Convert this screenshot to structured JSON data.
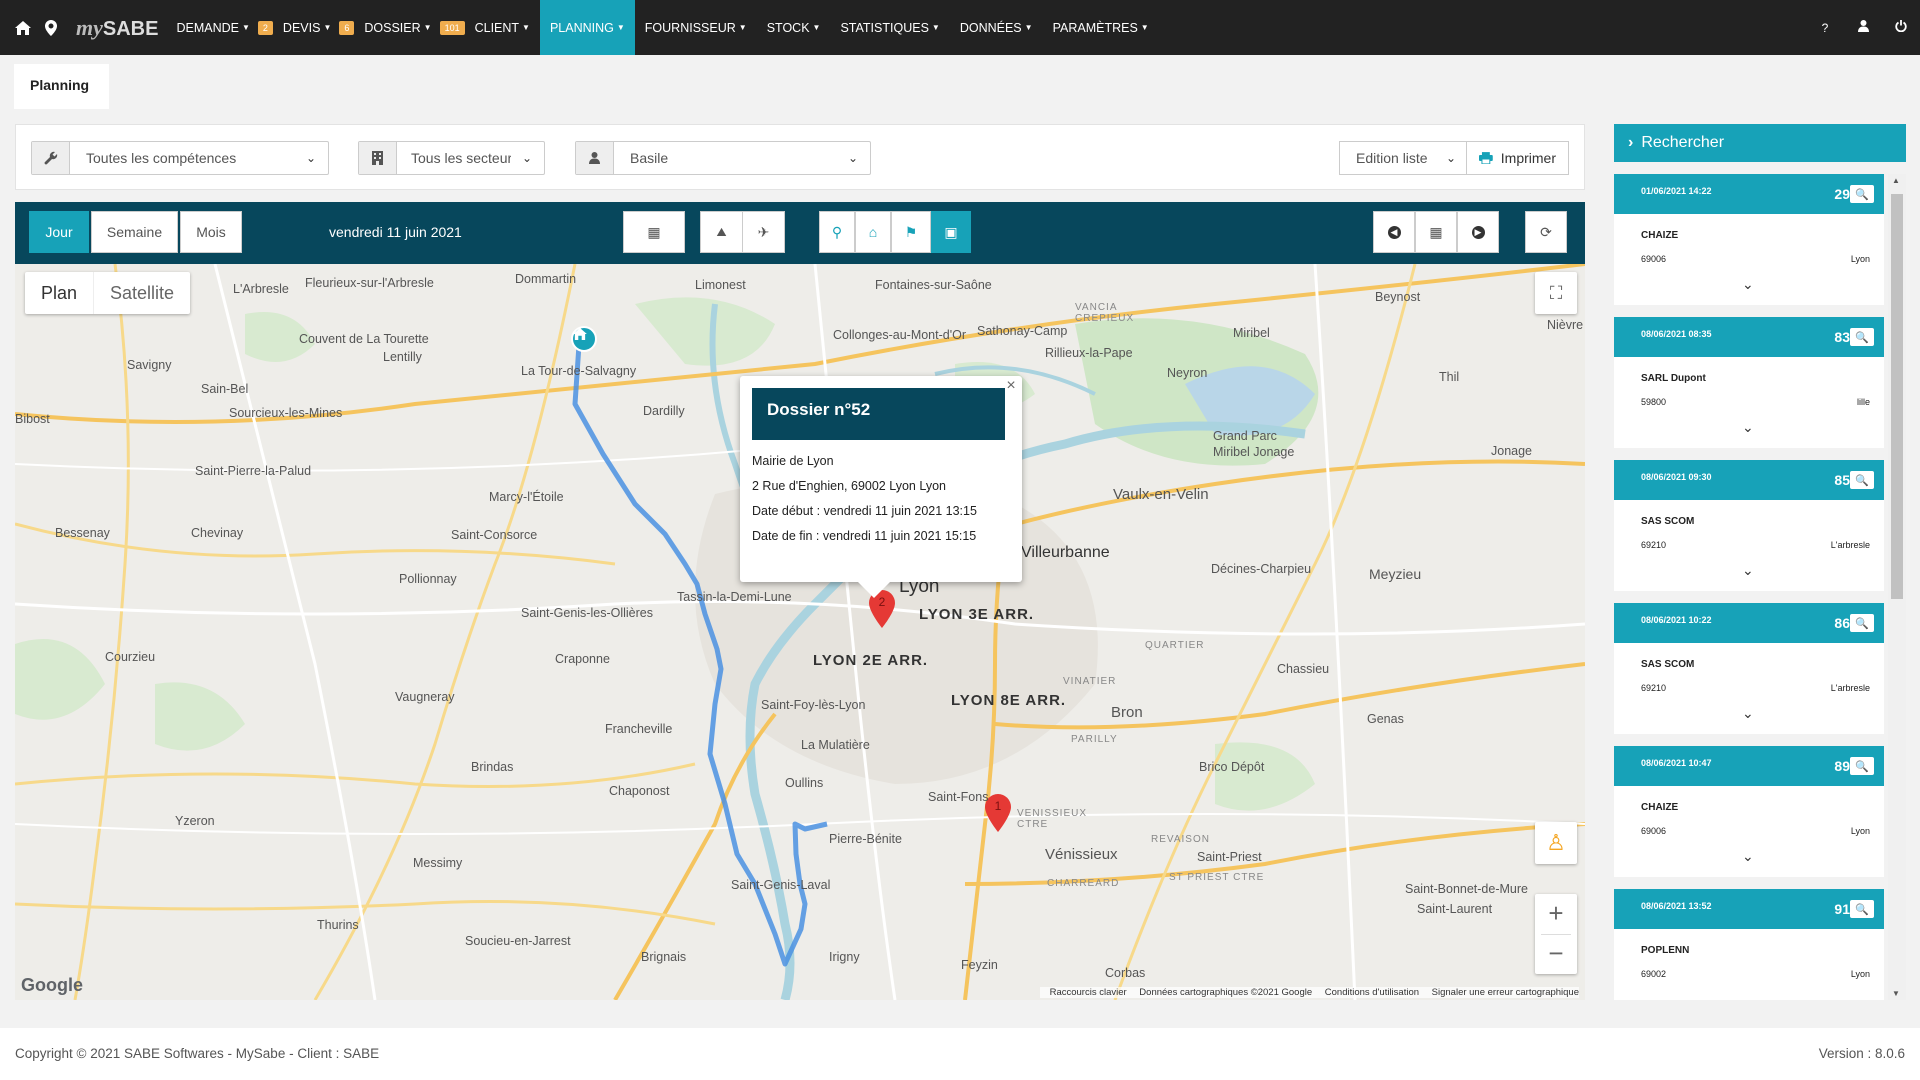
{
  "nav": {
    "logo_my": "my",
    "logo_sabe": "SABE",
    "items": [
      {
        "label": "DEMANDE",
        "badge": "2"
      },
      {
        "label": "DEVIS",
        "badge": "6"
      },
      {
        "label": "DOSSIER",
        "badge": "101"
      },
      {
        "label": "CLIENT",
        "badge": ""
      },
      {
        "label": "PLANNING",
        "badge": ""
      },
      {
        "label": "FOURNISSEUR",
        "badge": ""
      },
      {
        "label": "STOCK",
        "badge": ""
      },
      {
        "label": "STATISTIQUES",
        "badge": ""
      },
      {
        "label": "DONNÉES",
        "badge": ""
      },
      {
        "label": "PARAMÈTRES",
        "badge": ""
      }
    ],
    "help": "?"
  },
  "page": {
    "tab": "Planning"
  },
  "filters": {
    "competences": "Toutes les compétences",
    "secteurs": "Tous les secteurs",
    "user": "Basile",
    "edition": "Edition liste",
    "print": "Imprimer"
  },
  "planbar": {
    "jour": "Jour",
    "semaine": "Semaine",
    "mois": "Mois",
    "date": "vendredi 11 juin 2021"
  },
  "map": {
    "plan": "Plan",
    "satellite": "Satellite",
    "popup": {
      "title": "Dossier n°52",
      "line1": "Mairie de Lyon",
      "line2": "2 Rue d'Enghien, 69002 Lyon Lyon",
      "line3": "Date début : vendredi 11 juin 2021 13:15",
      "line4": "Date de fin : vendredi 11 juin 2021 15:15"
    },
    "markers": {
      "m1": "1",
      "m2": "2"
    },
    "labels": [
      "L'Arbresle",
      "Fleurieux-sur-l'Arbresle",
      "Dommartin",
      "Limonest",
      "Fontaines-sur-Saône",
      "Couvent de La Tourette",
      "Lentilly",
      "La Tour-de-Salvagny",
      "Collonges-au-Mont-d'Or",
      "Sathonay-Camp",
      "Rillieux-la-Pape",
      "Miribel",
      "Beynost",
      "Savigny",
      "Sain-Bel",
      "Sourcieux-les-Mines",
      "Dardilly",
      "Neyron",
      "Thil",
      "Bibost",
      "Saint-Pierre-la-Palud",
      "Grand Parc Miribel Jonage",
      "Jonage",
      "Marcy-l'Étoile",
      "Vaulx-en-Velin",
      "Bessenay",
      "Chevinay",
      "Saint-Consorce",
      "Villeurbanne",
      "Décines-Charpieu",
      "Meyzieu",
      "Pollionnay",
      "Tassin-la-Demi-Lune",
      "Lyon",
      "Saint-Genis-les-Ollières",
      "Courzieu",
      "Craponne",
      "Chassieu",
      "Vaugneray",
      "Saint-Foy-lès-Lyon",
      "Bron",
      "Genas",
      "Francheville",
      "La Mulatière",
      "Brindas",
      "Chaponost",
      "Oullins",
      "Saint-Fons",
      "Brico Dépôt",
      "Yzeron",
      "Pierre-Bénite",
      "Vénissieux",
      "Saint-Priest",
      "Messimy",
      "Saint-Genis-Laval",
      "Saint-Bonnet-de-Mure",
      "Saint-Laurent",
      "Thurins",
      "Soucieu-en-Jarrest",
      "Brignais",
      "Irigny",
      "Feyzin",
      "Corbas",
      "Nièvre"
    ],
    "districts": [
      "LYON 3E ARR.",
      "LYON 2E ARR.",
      "LYON 8E ARR."
    ],
    "small": [
      "VANCIA CREPIEUX",
      "QUARTIER",
      "VINATIER",
      "PARILLY",
      "REVAISON",
      "ST PRIEST CTRE",
      "CHARREARD",
      "VENISSIEUX CTRE"
    ],
    "footer": {
      "shortcuts": "Raccourcis clavier",
      "data": "Données cartographiques ©2021 Google",
      "terms": "Conditions d'utilisation",
      "report": "Signaler une erreur cartographique",
      "google": "Google"
    }
  },
  "sidebar": {
    "title": "Rechercher",
    "cards": [
      {
        "date": "01/06/2021 14:22",
        "num": "29",
        "name": "CHAIZE",
        "zip": "69006",
        "city": "Lyon"
      },
      {
        "date": "08/06/2021 08:35",
        "num": "83",
        "name": "SARL Dupont",
        "zip": "59800",
        "city": "lille"
      },
      {
        "date": "08/06/2021 09:30",
        "num": "85",
        "name": "SAS SCOM",
        "zip": "69210",
        "city": "L'arbresle"
      },
      {
        "date": "08/06/2021 10:22",
        "num": "86",
        "name": "SAS SCOM",
        "zip": "69210",
        "city": "L'arbresle"
      },
      {
        "date": "08/06/2021 10:47",
        "num": "89",
        "name": "CHAIZE",
        "zip": "69006",
        "city": "Lyon"
      },
      {
        "date": "08/06/2021 13:52",
        "num": "91",
        "name": "POPLENN",
        "zip": "69002",
        "city": "Lyon"
      }
    ]
  },
  "footer": {
    "copyright": "Copyright © 2021 SABE Softwares - MySabe - Client : SABE",
    "version": "Version : 8.0.6"
  },
  "colors": {
    "accent": "#17a2b8",
    "dark": "#07475c",
    "nav": "#222222",
    "badge": "#f0ad4e",
    "route": "#4a90e2",
    "marker": "#e53935"
  }
}
